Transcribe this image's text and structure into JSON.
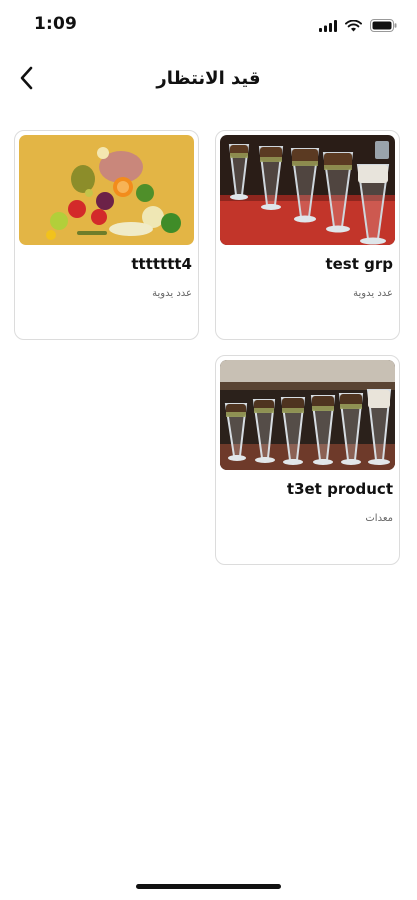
{
  "status_bar": {
    "time": "1:09"
  },
  "nav": {
    "title": "قيد الانتظار"
  },
  "products": [
    {
      "name": "test grp",
      "category": "عدد يدوية",
      "image": "glasses-photo"
    },
    {
      "name": "ttttttt4",
      "category": "عدد يدوية",
      "image": "vegetables-photo"
    },
    {
      "name": "t3et product",
      "category": "معدات",
      "image": "glasses-photo"
    }
  ],
  "colors": {
    "background": "#ffffff",
    "card_border": "#dcdcdc",
    "text": "#111111",
    "muted": "#666666"
  }
}
